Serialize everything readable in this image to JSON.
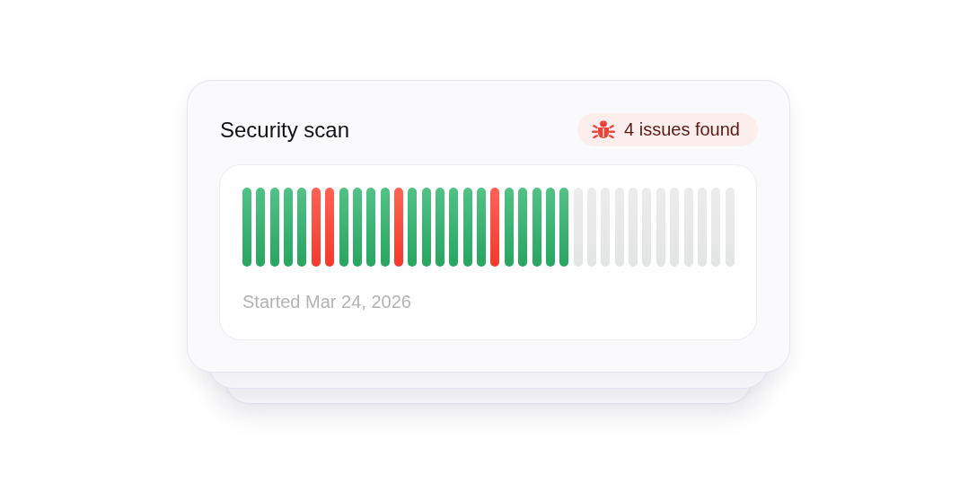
{
  "card": {
    "title": "Security scan",
    "badge": {
      "text": "4 issues found"
    },
    "bars": [
      {
        "kind": "pass"
      },
      {
        "kind": "pass"
      },
      {
        "kind": "pass"
      },
      {
        "kind": "pass"
      },
      {
        "kind": "pass"
      },
      {
        "kind": "fail"
      },
      {
        "kind": "fail"
      },
      {
        "kind": "pass"
      },
      {
        "kind": "pass"
      },
      {
        "kind": "pass"
      },
      {
        "kind": "pass"
      },
      {
        "kind": "fail"
      },
      {
        "kind": "pass"
      },
      {
        "kind": "pass"
      },
      {
        "kind": "pass"
      },
      {
        "kind": "pass"
      },
      {
        "kind": "pass"
      },
      {
        "kind": "pass"
      },
      {
        "kind": "fail"
      },
      {
        "kind": "pass"
      },
      {
        "kind": "pass"
      },
      {
        "kind": "pass"
      },
      {
        "kind": "pass"
      },
      {
        "kind": "pass"
      },
      {
        "kind": "pending"
      },
      {
        "kind": "pending"
      },
      {
        "kind": "pending"
      },
      {
        "kind": "pending"
      },
      {
        "kind": "pending"
      },
      {
        "kind": "pending"
      },
      {
        "kind": "pending"
      },
      {
        "kind": "pending"
      },
      {
        "kind": "pending"
      },
      {
        "kind": "pending"
      },
      {
        "kind": "pending"
      },
      {
        "kind": "pending"
      }
    ],
    "started": "Started Mar 24, 2026"
  }
}
